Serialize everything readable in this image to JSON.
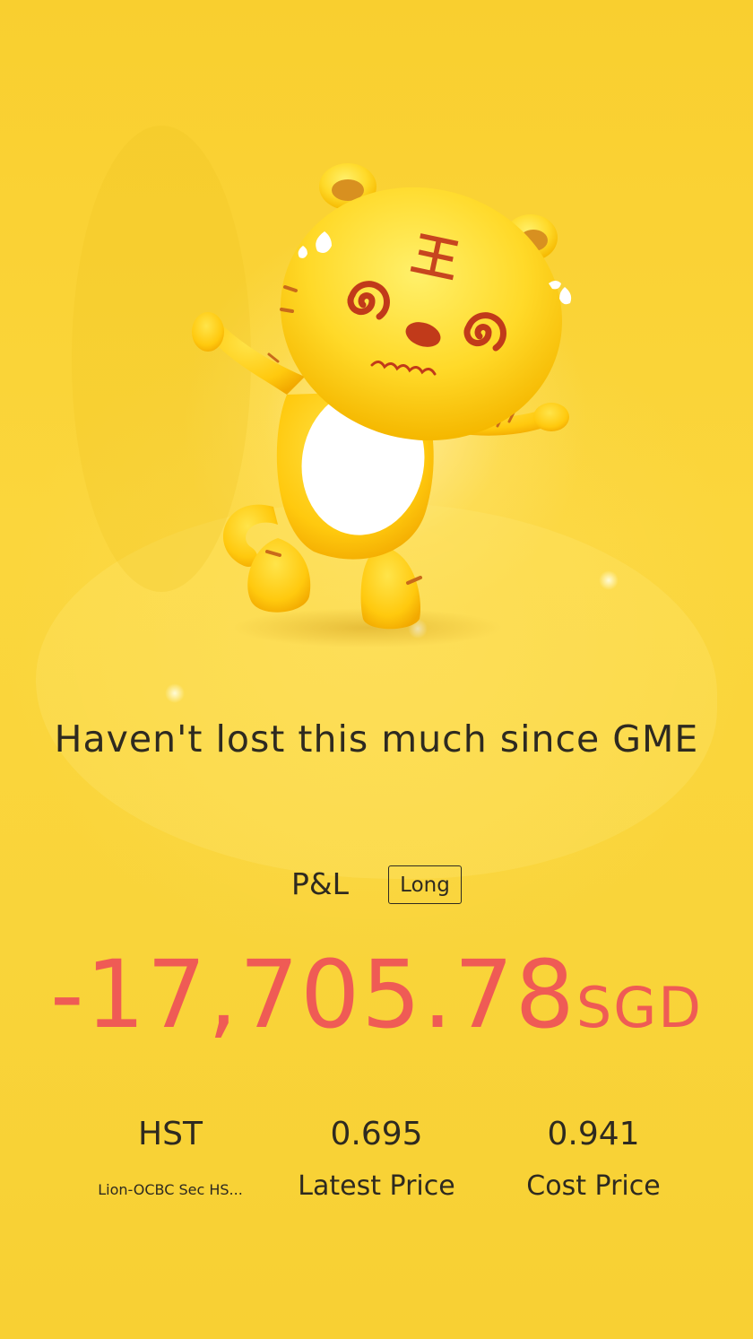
{
  "headline": "Haven't lost this much since GME",
  "pnl": {
    "label": "P&L",
    "position_badge": "Long",
    "amount": "-17,705.78",
    "currency": "SGD"
  },
  "stock": {
    "symbol": "HST",
    "name": "Lion-OCBC Sec HS...",
    "latest_price": "0.695",
    "latest_price_label": "Latest Price",
    "cost_price": "0.941",
    "cost_price_label": "Cost Price"
  },
  "colors": {
    "background": "#f9d234",
    "loss": "#ef5b55",
    "text": "#2e2a20"
  },
  "mascot": {
    "icon": "dizzy-tiger-mascot",
    "forehead_mark": "王"
  }
}
